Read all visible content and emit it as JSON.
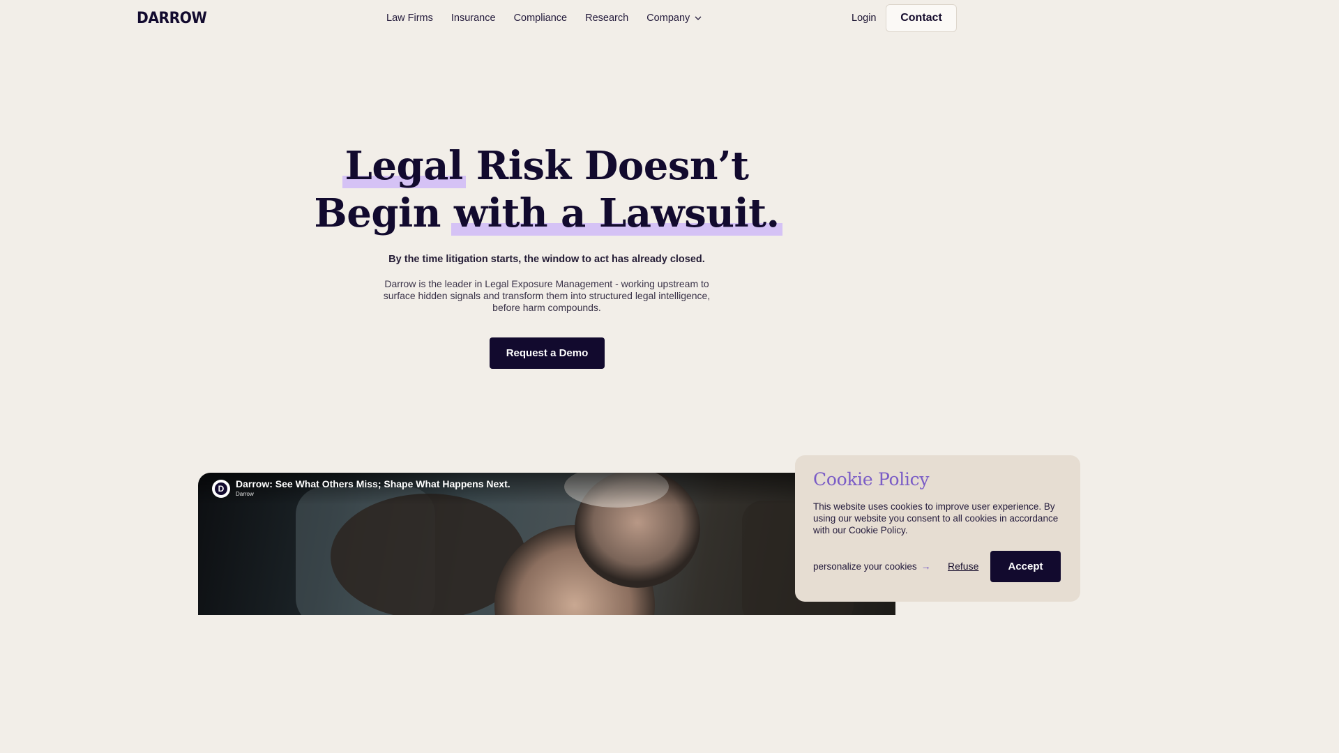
{
  "header": {
    "logo": "DARROW",
    "nav": [
      {
        "label": "Law Firms"
      },
      {
        "label": "Insurance"
      },
      {
        "label": "Compliance"
      },
      {
        "label": "Research"
      },
      {
        "label": "Company",
        "icon": "chevron-down-icon"
      }
    ],
    "login_label": "Login",
    "contact_label": "Contact"
  },
  "hero": {
    "title_line1_highlight": "Legal",
    "title_line1_rest": " Risk Doesn’t",
    "title_line2_start": "Begin ",
    "title_line2_highlight": "with a Lawsuit.",
    "subhead": "By the time litigation starts, the window to act has already closed.",
    "description": "Darrow is the leader in Legal Exposure Management - working upstream to surface hidden signals and transform them into structured legal intelligence, before harm compounds.",
    "cta_label": "Request a Demo",
    "highlight_color": "#d5c2f5"
  },
  "video": {
    "title": "Darrow: See What Others Miss; Shape What Happens Next.",
    "channel": "Darrow",
    "avatar_letter": "D"
  },
  "cookie": {
    "title": "Cookie Policy",
    "text": "This website uses cookies to improve user experience. By using our website you consent to all cookies in accordance with our Cookie Policy.",
    "personalize_label": "personalize your cookies",
    "personalize_icon": "arrow-right-icon",
    "refuse_label": "Refuse",
    "accept_label": "Accept"
  },
  "colors": {
    "background": "#f2eee8",
    "brand_dark": "#120a2e",
    "accent_purple": "#7a5cc6"
  }
}
